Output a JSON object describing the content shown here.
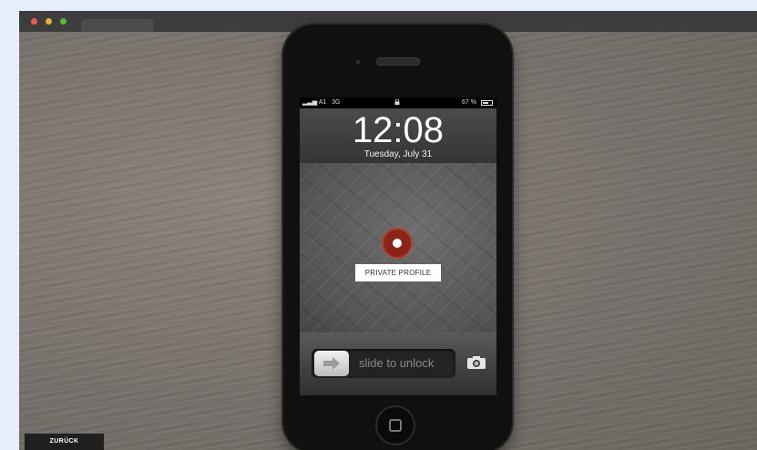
{
  "browser": {
    "controls": [
      "close",
      "minimize",
      "maximize"
    ]
  },
  "phone": {
    "status_bar": {
      "carrier": "A1",
      "network": "3G",
      "lock_icon": "lock-icon",
      "battery_text": "67 %",
      "battery_level": 0.67
    },
    "lock_screen": {
      "time": "12:08",
      "date": "Tuesday, July 31"
    },
    "record_button_icon": "record-icon",
    "profile_label": "PRIVATE PROFILE",
    "slider": {
      "text": "slide to unlock",
      "knob_icon": "arrow-right-icon"
    },
    "camera_icon": "camera-icon",
    "home_button_icon": "home-square-icon"
  },
  "navigation": {
    "back_label": "ZURÜCK"
  },
  "colors": {
    "record_red": "#8b2418",
    "titlebar": "#3d3d3d"
  }
}
